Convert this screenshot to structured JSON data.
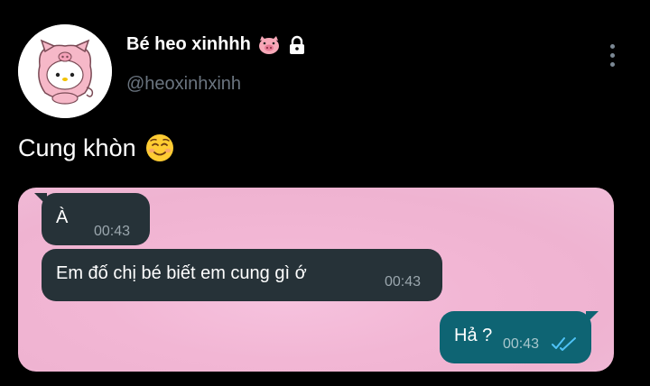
{
  "profile": {
    "display_name": "Bé heo xinhhh",
    "handle": "@heoxinhxinh",
    "avatar_icon": "hello-kitty-pig-avatar",
    "name_emoji": "pig-face-icon",
    "protected_icon": "lock-icon"
  },
  "tweet": {
    "text": "Cung khòn",
    "emoji": "smiling-face-icon"
  },
  "chat": {
    "messages": [
      {
        "direction": "incoming",
        "text": "À",
        "time": "00:43"
      },
      {
        "direction": "incoming",
        "text": "Em đố chị bé biết em cung gì ớ",
        "time": "00:43"
      },
      {
        "direction": "outgoing",
        "text": "Hả ?",
        "time": "00:43",
        "status_icon": "double-check-icon"
      }
    ]
  },
  "colors": {
    "background": "#000000",
    "incoming_bubble": "#263238",
    "outgoing_bubble": "#0e6473",
    "chat_background": "#f2b6d4",
    "handle_text": "#6b7580",
    "read_check": "#4fc3f7"
  }
}
